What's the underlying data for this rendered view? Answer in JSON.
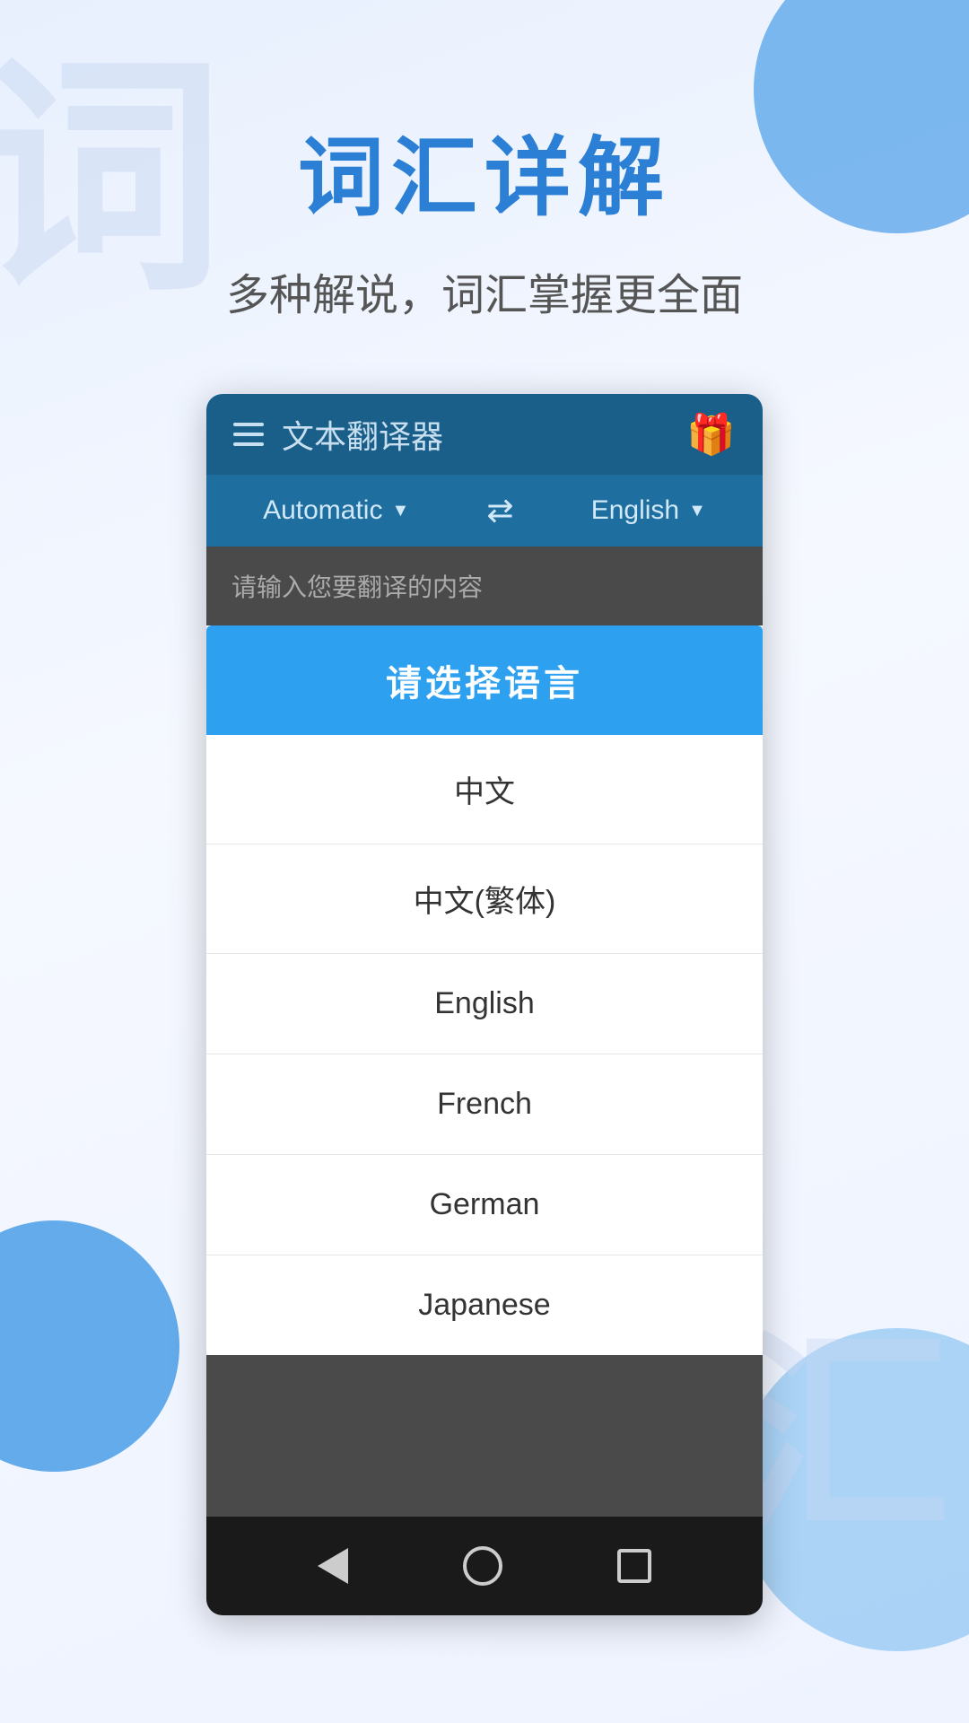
{
  "background": {
    "watermark_top": "词",
    "watermark_bottom": "汇"
  },
  "header": {
    "main_title": "词汇详解",
    "sub_title": "多种解说，词汇掌握更全面"
  },
  "app": {
    "toolbar": {
      "title": "文本翻译器",
      "gift_icon": "🎁"
    },
    "lang_bar": {
      "source_lang": "Automatic",
      "target_lang": "English",
      "swap_symbol": "⇄"
    },
    "input": {
      "placeholder": "请输入您要翻译的内容"
    },
    "dialog": {
      "title": "请选择语言",
      "languages": [
        {
          "id": "zh",
          "label": "中文"
        },
        {
          "id": "zh-tw",
          "label": "中文(繁体)"
        },
        {
          "id": "en",
          "label": "English"
        },
        {
          "id": "fr",
          "label": "French"
        },
        {
          "id": "de",
          "label": "German"
        },
        {
          "id": "ja",
          "label": "Japanese"
        }
      ]
    }
  },
  "nav": {
    "back_label": "back",
    "home_label": "home",
    "recent_label": "recent"
  }
}
